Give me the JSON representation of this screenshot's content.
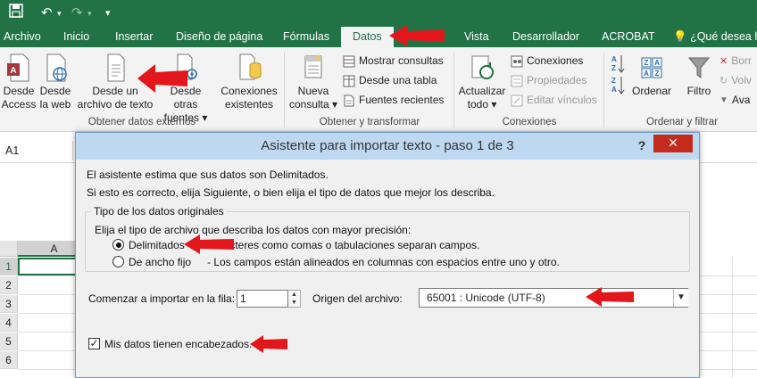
{
  "titlebar": {},
  "tabs": [
    "Archivo",
    "Inicio",
    "Insertar",
    "Diseño de página",
    "Fórmulas",
    "Datos",
    "Vista",
    "Desarrollador",
    "ACROBAT",
    "¿Qué desea hac"
  ],
  "ribbon": {
    "get_external": {
      "access": [
        "Desde",
        "Access"
      ],
      "web": [
        "Desde",
        "la web"
      ],
      "text": [
        "Desde un",
        "archivo de texto"
      ],
      "other": [
        "Desde otras",
        "fuentes ▾"
      ],
      "existing": [
        "Conexiones",
        "existentes"
      ],
      "group_label": "Obtener datos externos"
    },
    "transform": {
      "new_query": [
        "Nueva",
        "consulta ▾"
      ],
      "show_queries": "Mostrar consultas",
      "from_table": "Desde una tabla",
      "recent_sources": "Fuentes recientes",
      "group_label": "Obtener y transformar"
    },
    "connections": {
      "refresh": [
        "Actualizar",
        "todo ▾"
      ],
      "connections": "Conexiones",
      "properties": "Propiedades",
      "edit_links": "Editar vínculos",
      "group_label": "Conexiones"
    },
    "sort_filter": {
      "sort": "Ordenar",
      "filter": "Filtro",
      "clear": "Borr",
      "reapply": "Volv",
      "advanced": "Ava",
      "group_label": "Ordenar y filtrar"
    }
  },
  "namebox": "A1",
  "grid": {
    "column": "A",
    "rows": [
      "1",
      "2",
      "3",
      "4",
      "5",
      "6"
    ]
  },
  "dialog": {
    "title": "Asistente para importar texto - paso 1 de 3",
    "help": "?",
    "close": "✕",
    "line1": "El asistente estima que sus datos son Delimitados.",
    "line2": "Si esto es correcto, elija Siguiente, o bien elija el tipo de datos que mejor los describa.",
    "fieldset_legend": "Tipo de los datos originales",
    "fieldset_prompt": "Elija el tipo de archivo que describa los datos con mayor precisión:",
    "opt_delimited_label": "Delimitados",
    "opt_delimited_desc": "- Caracteres como comas o tabulaciones separan campos.",
    "opt_fixed_label": "De ancho fijo",
    "opt_fixed_desc": "- Los campos están alineados en columnas con espacios entre uno y otro.",
    "start_row_label": "Comenzar a importar en la fila:",
    "start_row_value": "1",
    "origin_label": "Origen del archivo:",
    "origin_value": "65001 : Unicode (UTF-8)",
    "headers_label": "Mis datos tienen encabezados.",
    "headers_checked": true
  },
  "colors": {
    "excel_green": "#217346",
    "annotation_red": "#e3161b",
    "dialog_title_bg": "#bdd8f0",
    "close_red": "#c42b1c"
  }
}
